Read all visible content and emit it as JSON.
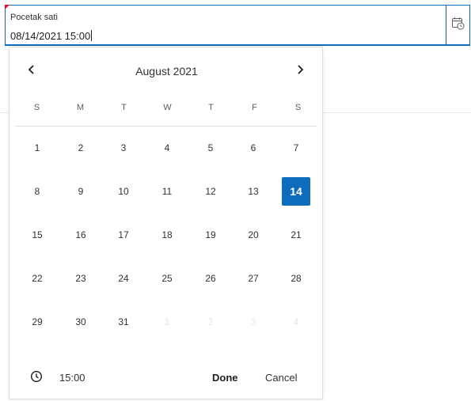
{
  "field": {
    "label": "Pocetak sati",
    "value": "08/14/2021 15:00"
  },
  "calendar": {
    "month_title": "August 2021",
    "weekdays": [
      "S",
      "M",
      "T",
      "W",
      "T",
      "F",
      "S"
    ],
    "weeks": [
      [
        "1",
        "2",
        "3",
        "4",
        "5",
        "6",
        "7"
      ],
      [
        "8",
        "9",
        "10",
        "11",
        "12",
        "13",
        "14"
      ],
      [
        "15",
        "16",
        "17",
        "18",
        "19",
        "20",
        "21"
      ],
      [
        "22",
        "23",
        "24",
        "25",
        "26",
        "27",
        "28"
      ],
      [
        "29",
        "30",
        "31",
        "1",
        "2",
        "3",
        "4"
      ]
    ],
    "selected_day": "14",
    "muted_trailing_days": [
      "1",
      "2",
      "3",
      "4"
    ]
  },
  "footer": {
    "time": "15:00",
    "done_label": "Done",
    "cancel_label": "Cancel"
  },
  "icons": {
    "calendar": "calendar-clock-icon",
    "prev": "chevron-left-icon",
    "next": "chevron-right-icon",
    "clock": "clock-icon"
  },
  "colors": {
    "accent": "#0f6cbd",
    "required_marker": "#e81123"
  }
}
